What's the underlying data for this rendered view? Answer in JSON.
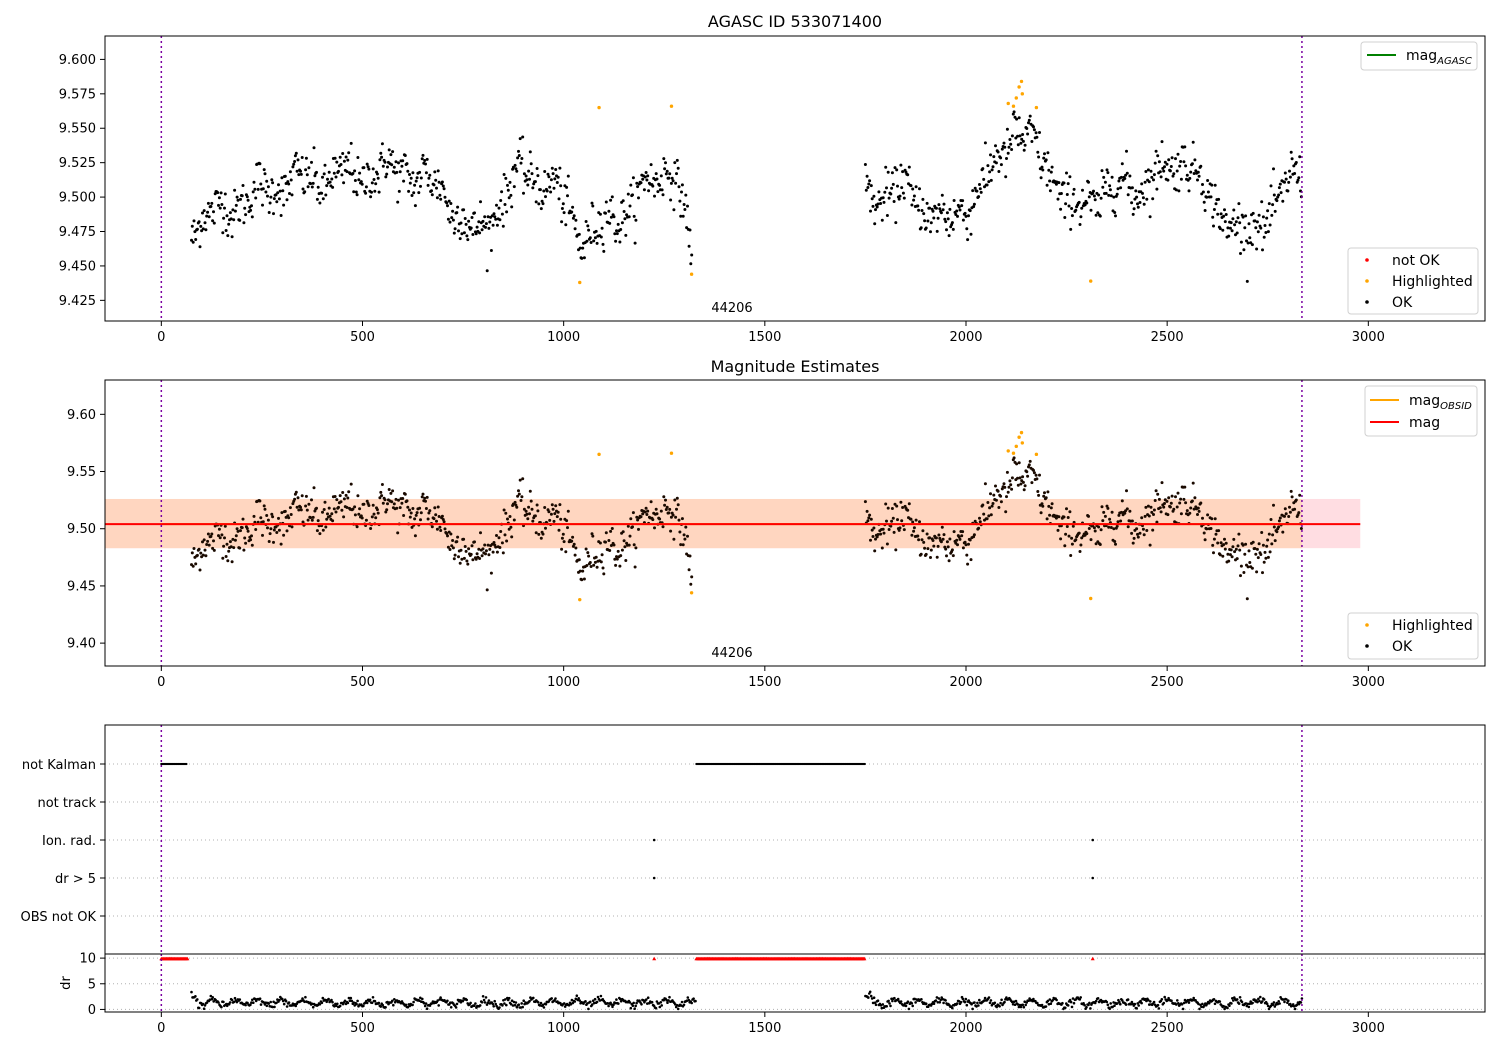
{
  "chart_data": [
    {
      "id": "agasc",
      "type": "scatter",
      "title": "AGASC ID 533071400",
      "xlim": [
        -140,
        3290
      ],
      "ylim": [
        9.41,
        9.617
      ],
      "xticks": [
        "0",
        "500",
        "1000",
        "1500",
        "2000",
        "2500",
        "3000"
      ],
      "yticks": [
        "9.425",
        "9.450",
        "9.475",
        "9.500",
        "9.525",
        "9.550",
        "9.575",
        "9.600"
      ],
      "annotation": "44206",
      "vlines": [
        0,
        2835
      ],
      "legend_lines": [
        {
          "label_main": "mag",
          "label_sub": "AGASC",
          "color": "#008000"
        }
      ],
      "legend_points": [
        {
          "label": "not OK",
          "color": "#ff0000"
        },
        {
          "label": "Highlighted",
          "color": "#ffa500"
        },
        {
          "label": "OK",
          "color": "#000000"
        }
      ],
      "segments": [
        {
          "x": [
            75,
            300,
            600,
            700,
            780,
            900,
            980,
            1050,
            1150,
            1270,
            1320
          ],
          "y": [
            9.48,
            9.51,
            9.52,
            9.505,
            9.47,
            9.52,
            9.505,
            9.47,
            9.49,
            9.525,
            9.46
          ]
        },
        {
          "x": [
            1750,
            1850,
            1950,
            2050,
            2120,
            2200,
            2260,
            2350,
            2450,
            2550,
            2600,
            2700,
            2835
          ],
          "y": [
            9.5,
            9.505,
            9.48,
            9.51,
            9.55,
            9.525,
            9.49,
            9.505,
            9.51,
            9.53,
            9.5,
            9.47,
            9.52
          ]
        }
      ],
      "highlighted": [
        {
          "x": 1088,
          "y": 9.565
        },
        {
          "x": 1268,
          "y": 9.566
        },
        {
          "x": 1040,
          "y": 9.438
        },
        {
          "x": 1318,
          "y": 9.444
        },
        {
          "x": 2105,
          "y": 9.568
        },
        {
          "x": 2125,
          "y": 9.572
        },
        {
          "x": 2132,
          "y": 9.58
        },
        {
          "x": 2138,
          "y": 9.584
        },
        {
          "x": 2140,
          "y": 9.575
        },
        {
          "x": 2118,
          "y": 9.566
        },
        {
          "x": 2175,
          "y": 9.565
        },
        {
          "x": 2310,
          "y": 9.439
        }
      ]
    },
    {
      "id": "magest",
      "type": "scatter",
      "title": "Magnitude Estimates",
      "xlim": [
        -140,
        3290
      ],
      "ylim": [
        9.38,
        9.63
      ],
      "xticks": [
        "0",
        "500",
        "1000",
        "1500",
        "2000",
        "2500",
        "3000"
      ],
      "yticks": [
        "9.40",
        "9.45",
        "9.50",
        "9.55",
        "9.60"
      ],
      "annotation": "44206",
      "vlines": [
        0,
        2835
      ],
      "mag": 9.504,
      "band_lower": 9.483,
      "band_upper": 9.526,
      "band_x": [
        -140,
        2980
      ],
      "legend_lines": [
        {
          "label_main": "mag",
          "label_sub": "OBSID",
          "color": "#ffa500"
        },
        {
          "label_main": "mag",
          "label_sub": "",
          "color": "#ff0000"
        }
      ],
      "legend_points": [
        {
          "label": "Highlighted",
          "color": "#ffa500"
        },
        {
          "label": "OK",
          "color": "#000000"
        }
      ]
    },
    {
      "id": "flags",
      "type": "scatter",
      "xlim": [
        -140,
        3290
      ],
      "categories": [
        "not Kalman",
        "not track",
        "Ion. rad.",
        "dr > 5",
        "OBS not OK"
      ],
      "vlines": [
        0,
        2835
      ],
      "not_kalman_ranges": [
        [
          0,
          65
        ],
        [
          1330,
          1750
        ]
      ],
      "ion_rad_x": [
        1225,
        2315
      ],
      "dr5_x": [
        1225,
        2315
      ]
    },
    {
      "id": "dr",
      "type": "scatter",
      "ylabel": "dr",
      "xlim": [
        -140,
        3290
      ],
      "ylim": [
        -0.5,
        10.8
      ],
      "yticks": [
        "0",
        "5",
        "10"
      ],
      "xticks": [
        "0",
        "500",
        "1000",
        "1500",
        "2000",
        "2500",
        "3000"
      ],
      "vlines": [
        0,
        2835
      ],
      "red_ranges": [
        [
          0,
          65
        ],
        [
          1330,
          1750
        ]
      ],
      "red_points_x": [
        1225,
        2315
      ],
      "red_value": 9.8,
      "dr_segments": [
        [
          75,
          1330
        ],
        [
          1750,
          2835
        ]
      ],
      "dr_mean": 1.3
    }
  ]
}
